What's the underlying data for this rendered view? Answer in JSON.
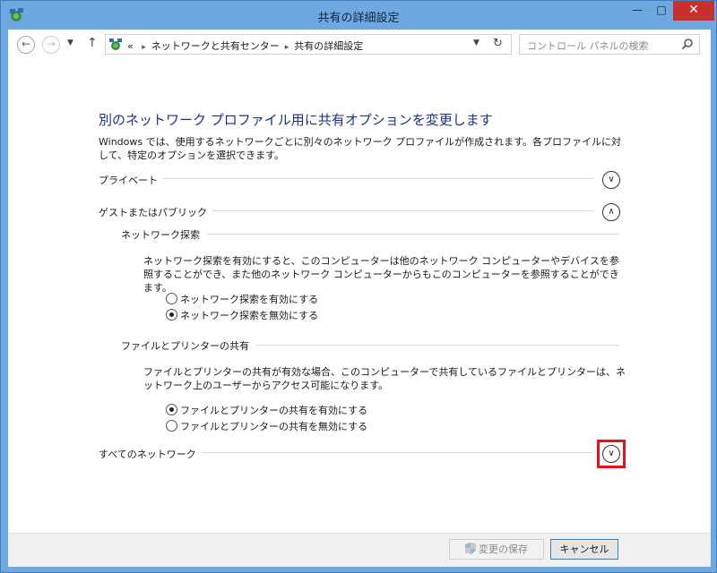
{
  "window": {
    "title": "共有の詳細設定",
    "minimize": "—",
    "maximize": "□",
    "close": "✕"
  },
  "nav": {
    "breadcrumb_prefix": "«",
    "breadcrumb_1": "ネットワークと共有センター",
    "breadcrumb_2": "共有の詳細設定",
    "search_placeholder": "コントロール パネルの検索"
  },
  "page": {
    "heading": "別のネットワーク プロファイル用に共有オプションを変更します",
    "description": "Windows では、使用するネットワークごとに別々のネットワーク プロファイルが作成されます。各プロファイルに対して、特定のオプションを選択できます。"
  },
  "sections": {
    "private": {
      "label": "プライベート",
      "expanded": false
    },
    "guest": {
      "label": "ゲストまたはパブリック",
      "expanded": true
    },
    "all": {
      "label": "すべてのネットワーク",
      "expanded": false
    }
  },
  "network_discovery": {
    "label": "ネットワーク探索",
    "description": "ネットワーク探索を有効にすると、このコンピューターは他のネットワーク コンピューターやデバイスを参照することができ、また他のネットワーク コンピューターからもこのコンピューターを参照することができます。",
    "option_on": "ネットワーク探索を有効にする",
    "option_off": "ネットワーク探索を無効にする",
    "selected": "off"
  },
  "file_printer_sharing": {
    "label": "ファイルとプリンターの共有",
    "description": "ファイルとプリンターの共有が有効な場合、このコンピューターで共有しているファイルとプリンターは、ネットワーク上のユーザーからアクセス可能になります。",
    "option_on": "ファイルとプリンターの共有を有効にする",
    "option_off": "ファイルとプリンターの共有を無効にする",
    "selected": "on"
  },
  "footer": {
    "save_label": "変更の保存",
    "cancel_label": "キャンセル"
  },
  "colors": {
    "heading": "#1e3287",
    "highlight": "#e0141e",
    "titlebar": "#6ea8e0"
  }
}
